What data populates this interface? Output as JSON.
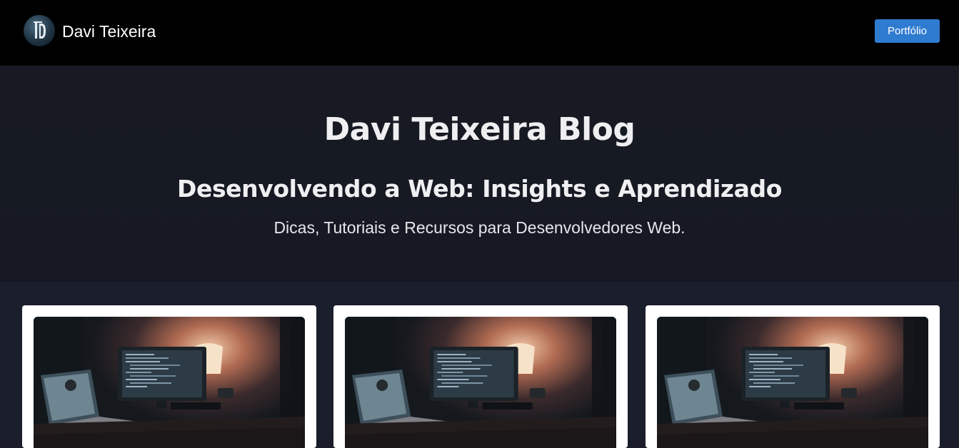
{
  "navbar": {
    "logo_icon": "initials-logo-icon",
    "brand_name": "Davi Teixeira",
    "portfolio_label": "Portfólio"
  },
  "hero": {
    "title": "Davi Teixeira Blog",
    "subtitle": "Desenvolvendo a Web: Insights e Aprendizado",
    "tagline": "Dicas, Tutoriais e Recursos para Desenvolvedores Web."
  },
  "posts": {
    "cards": [
      {
        "image": "desk-computer-photo"
      },
      {
        "image": "desk-computer-photo"
      },
      {
        "image": "desk-computer-photo"
      }
    ]
  },
  "colors": {
    "navbar_bg": "#000000",
    "hero_bg": "#171a22",
    "posts_bg": "#1b1f2c",
    "button_bg": "#2f7bd0",
    "heading_text": "#efeff2"
  }
}
